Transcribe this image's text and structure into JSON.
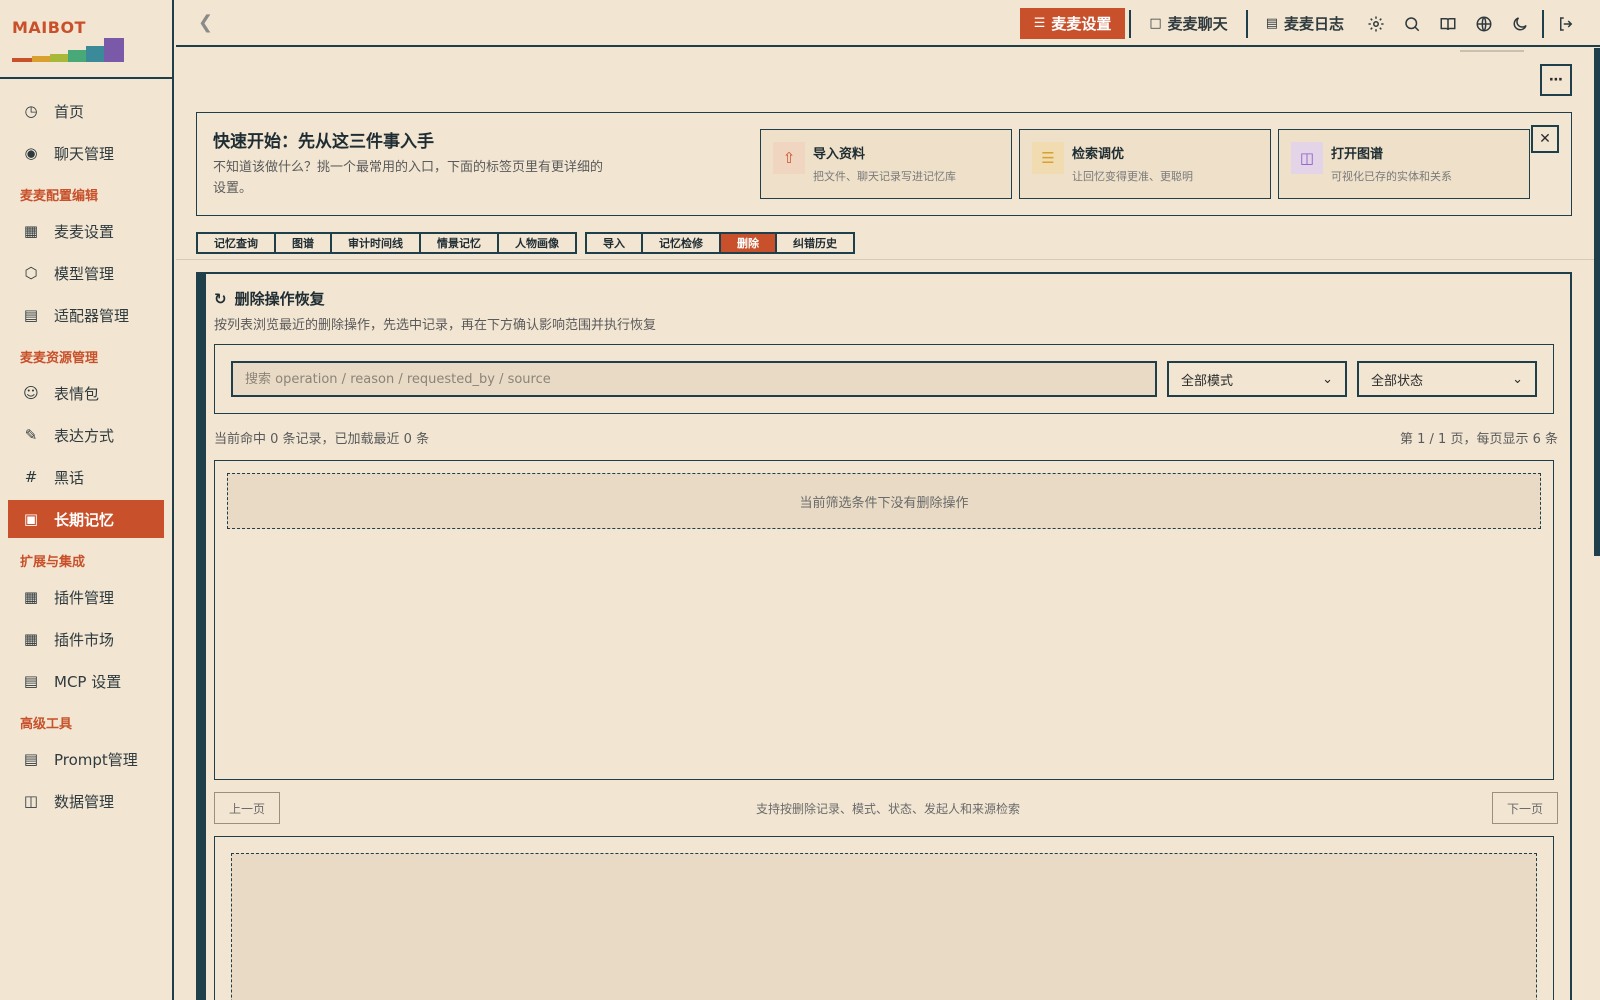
{
  "app": {
    "logo": "MAIBOT"
  },
  "sidebar": {
    "items": [
      {
        "label": "首页",
        "icon": "dashboard-icon",
        "active": false
      },
      {
        "label": "聊天管理",
        "icon": "chat-icon",
        "active": false
      },
      {
        "section": "麦麦配置编辑"
      },
      {
        "label": "麦麦设置",
        "icon": "settings-grid-icon",
        "active": false
      },
      {
        "label": "模型管理",
        "icon": "cube-icon",
        "active": false
      },
      {
        "label": "适配器管理",
        "icon": "router-icon",
        "active": false
      },
      {
        "section": "麦麦资源管理"
      },
      {
        "label": "表情包",
        "icon": "smile-icon",
        "active": false
      },
      {
        "label": "表达方式",
        "icon": "edit-note-icon",
        "active": false
      },
      {
        "label": "黑话",
        "icon": "hash-icon",
        "active": false
      },
      {
        "label": "长期记忆",
        "icon": "memory-icon",
        "active": true
      },
      {
        "section": "扩展与集成"
      },
      {
        "label": "插件管理",
        "icon": "plugin-grid-icon",
        "active": false
      },
      {
        "label": "插件市场",
        "icon": "store-icon",
        "active": false
      },
      {
        "label": "MCP 设置",
        "icon": "router-icon",
        "active": false
      },
      {
        "section": "高级工具"
      },
      {
        "label": "Prompt管理",
        "icon": "prompt-icon",
        "active": false
      },
      {
        "label": "数据管理",
        "icon": "database-icon",
        "active": false
      }
    ]
  },
  "topbar": {
    "buttons": [
      {
        "label": "麦麦设置",
        "icon": "sliders-icon"
      },
      {
        "label": "麦麦聊天",
        "icon": "message-icon"
      },
      {
        "label": "麦麦日志",
        "icon": "file-icon"
      }
    ]
  },
  "quick_start": {
    "title": "快速开始：先从这三件事入手",
    "desc": "不知道该做什么？挑一个最常用的入口，下面的标签页里有更详细的设置。",
    "cards": [
      {
        "title": "导入资料",
        "desc": "把文件、聊天记录写进记忆库",
        "icon": "upload-icon",
        "color": "#c8502a"
      },
      {
        "title": "检索调优",
        "desc": "让回忆变得更准、更聪明",
        "icon": "tune-icon",
        "color": "#d9a030"
      },
      {
        "title": "打开图谱",
        "desc": "可视化已存的实体和关系",
        "icon": "database-icon",
        "color": "#8a5cc8"
      }
    ]
  },
  "tabs": {
    "group1": [
      "记忆查询",
      "图谱",
      "审计时间线",
      "情景记忆",
      "人物画像"
    ],
    "group2": [
      "导入",
      "记忆检修",
      "删除",
      "纠错历史"
    ],
    "active": "删除"
  },
  "panel": {
    "title": "删除操作恢复",
    "subtitle": "按列表浏览最近的删除操作，先选中记录，再在下方确认影响范围并执行恢复",
    "search_placeholder": "搜索 operation / reason / requested_by / source",
    "mode_select": "全部模式",
    "status_select": "全部状态",
    "count_text": "当前命中 0 条记录，已加载最近 0 条",
    "page_text": "第 1 / 1 页，每页显示 6 条",
    "empty_text": "当前筛选条件下没有删除操作",
    "prev": "上一页",
    "next": "下一页",
    "hint": "支持按删除记录、模式、状态、发起人和来源检索"
  }
}
